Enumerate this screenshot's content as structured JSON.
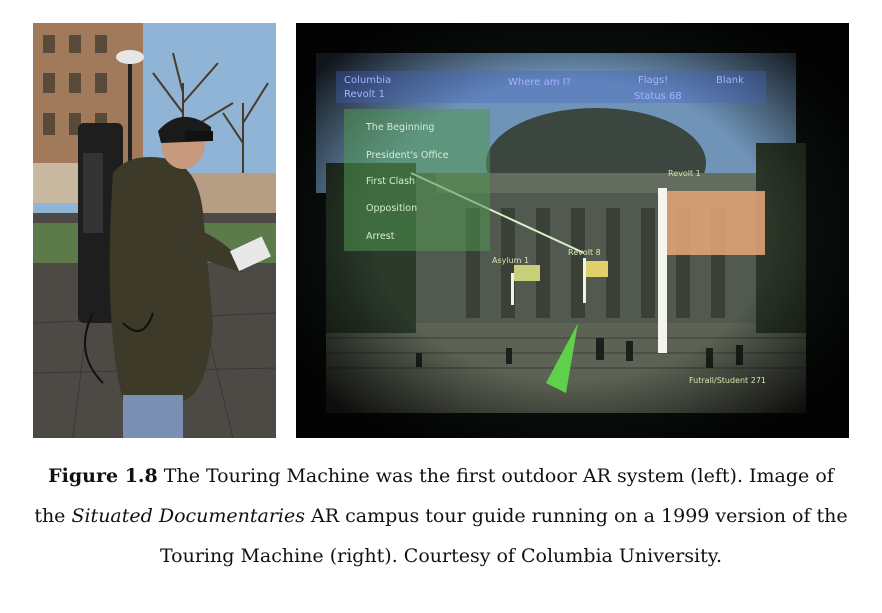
{
  "figure": {
    "label": "Figure 1.8",
    "text_1": " The Touring Machine was the first outdoor AR system (left). Image of the ",
    "italic_title": "Situated Documentaries",
    "text_2": " AR campus tour guide running on a 1999 version of the Touring Machine (right). Courtesy of Columbia University."
  },
  "ar_view": {
    "hud_top_left_1": "Columbia",
    "hud_top_left_2": "Revolt 1",
    "hud_where": "Where am I?",
    "hud_flags": "Flags!",
    "hud_blank": "Blank",
    "hud_status": "Status 68",
    "menu_items": [
      "The Beginning",
      "President's Office",
      "First Clash",
      "Opposition",
      "Arrest"
    ],
    "flag_label_1": "Asylum 1",
    "flag_label_2": "Revolt 8",
    "flag_label_3": "Revolt 1",
    "bottom_right_label": "Futrall/Student 271"
  }
}
